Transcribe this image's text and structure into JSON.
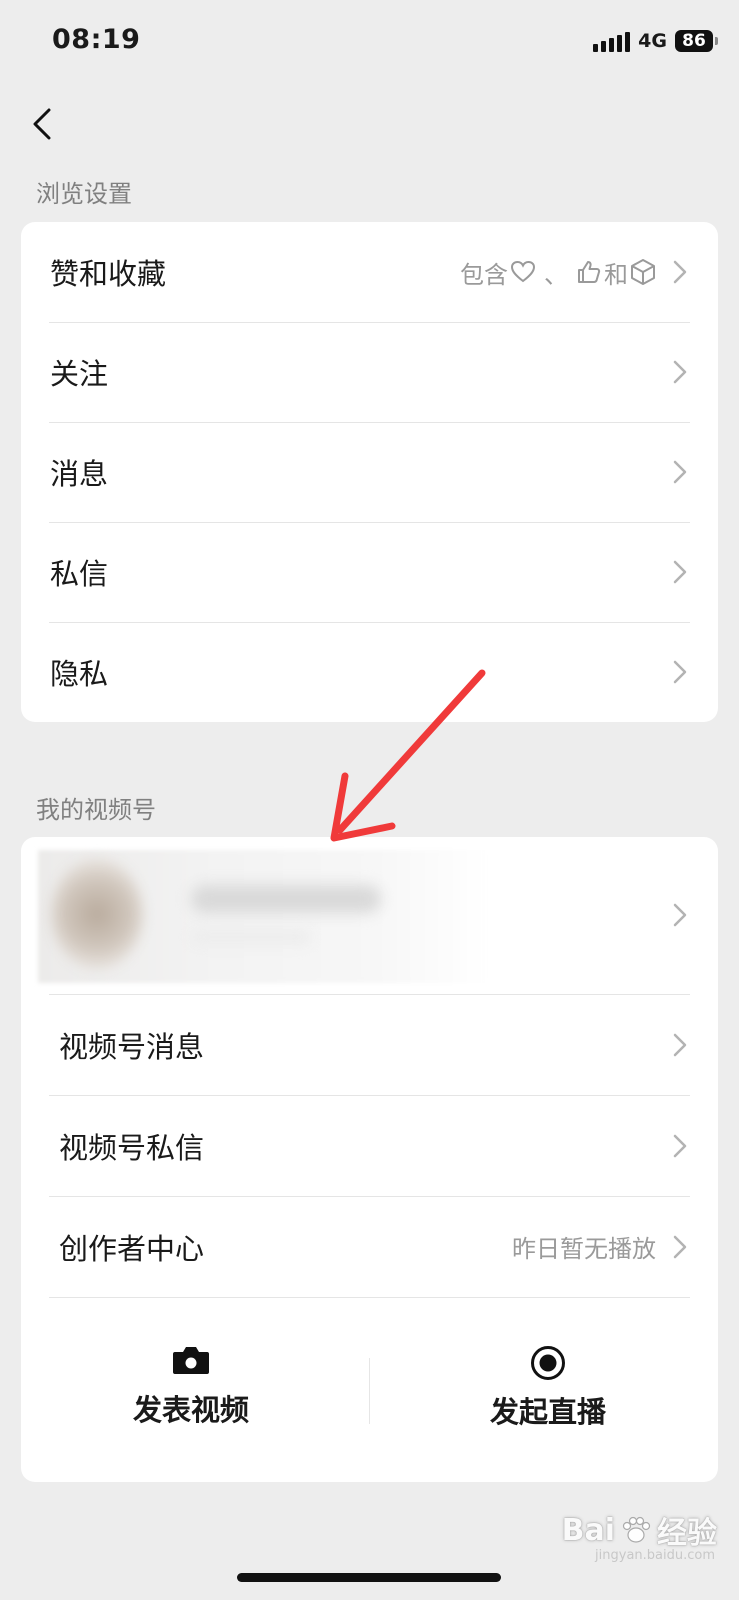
{
  "status_bar": {
    "time": "08:19",
    "network": "4G",
    "battery": "86"
  },
  "browse_settings": {
    "title": "浏览设置",
    "items": [
      {
        "label": "赞和收藏",
        "extra_prefix": "包含",
        "extra_sep": "、",
        "extra_and": "和"
      },
      {
        "label": "关注"
      },
      {
        "label": "消息"
      },
      {
        "label": "私信"
      },
      {
        "label": "隐私"
      }
    ]
  },
  "my_channels": {
    "title": "我的视频号",
    "items": [
      {
        "label": "视频号消息"
      },
      {
        "label": "视频号私信"
      },
      {
        "label": "创作者中心",
        "extra": "昨日暂无播放"
      }
    ],
    "actions": {
      "post_video": "发表视频",
      "start_live": "发起直播"
    }
  },
  "watermark": {
    "brand": "Bai",
    "brand_tail": "经验",
    "url": "jingyan.baidu.com"
  },
  "colors": {
    "background": "#ededed",
    "card": "#ffffff",
    "secondary_text": "#9a9a9a",
    "arrow": "#f03a3a"
  }
}
